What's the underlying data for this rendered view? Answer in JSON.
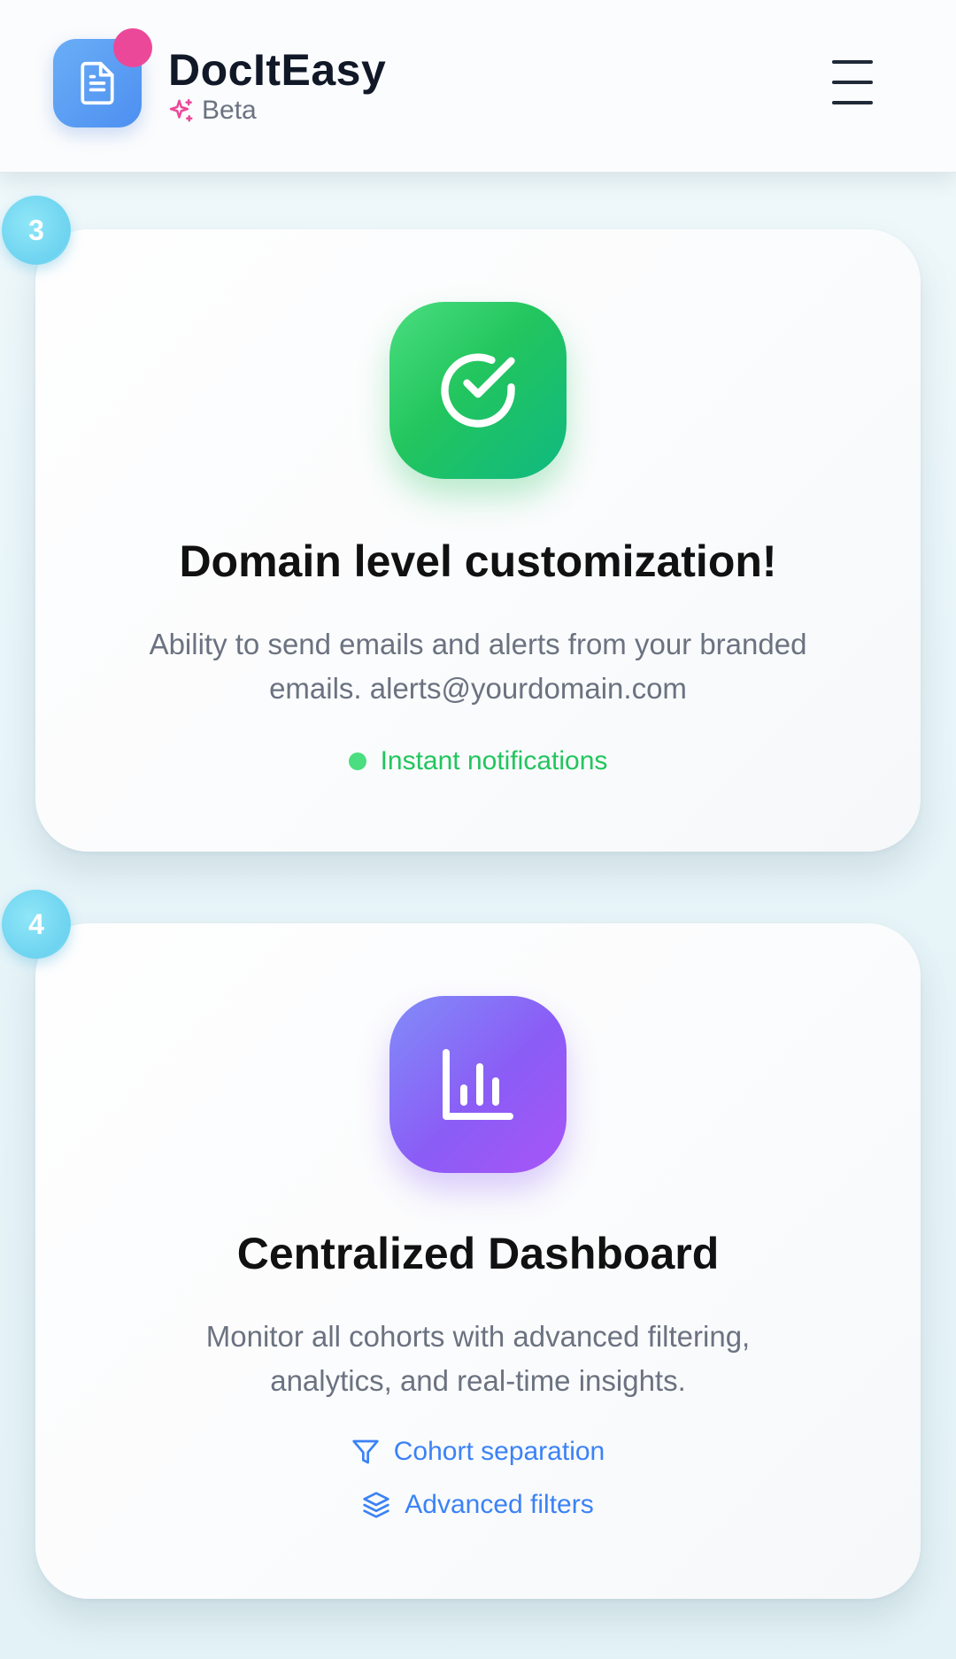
{
  "header": {
    "brand_name": "DocItEasy",
    "beta_label": "Beta",
    "logo_icon": "document-icon",
    "sparkle_icon": "sparkle-icon",
    "menu_icon": "hamburger-menu-icon"
  },
  "cards": [
    {
      "step": "3",
      "icon": "check-circle-icon",
      "title": "Domain level customization!",
      "description": "Ability to send emails and alerts from your branded emails. alerts@yourdomain.com",
      "features": [
        {
          "icon": "green-dot",
          "label": "Instant notifications"
        }
      ],
      "accent_color": "#22c55e"
    },
    {
      "step": "4",
      "icon": "bar-chart-icon",
      "title": "Centralized Dashboard",
      "description": "Monitor all cohorts with advanced filtering, analytics, and real-time insights.",
      "features": [
        {
          "icon": "filter-icon",
          "label": "Cohort separation"
        },
        {
          "icon": "layers-icon",
          "label": "Advanced filters"
        }
      ],
      "accent_color": "#3b82f6"
    }
  ],
  "colors": {
    "brand_blue": "#4d8ff0",
    "notification_pink": "#ec4899",
    "step_badge_cyan": "#6dd3f0",
    "green_accent": "#22c55e",
    "purple_accent": "#8b5cf6"
  }
}
